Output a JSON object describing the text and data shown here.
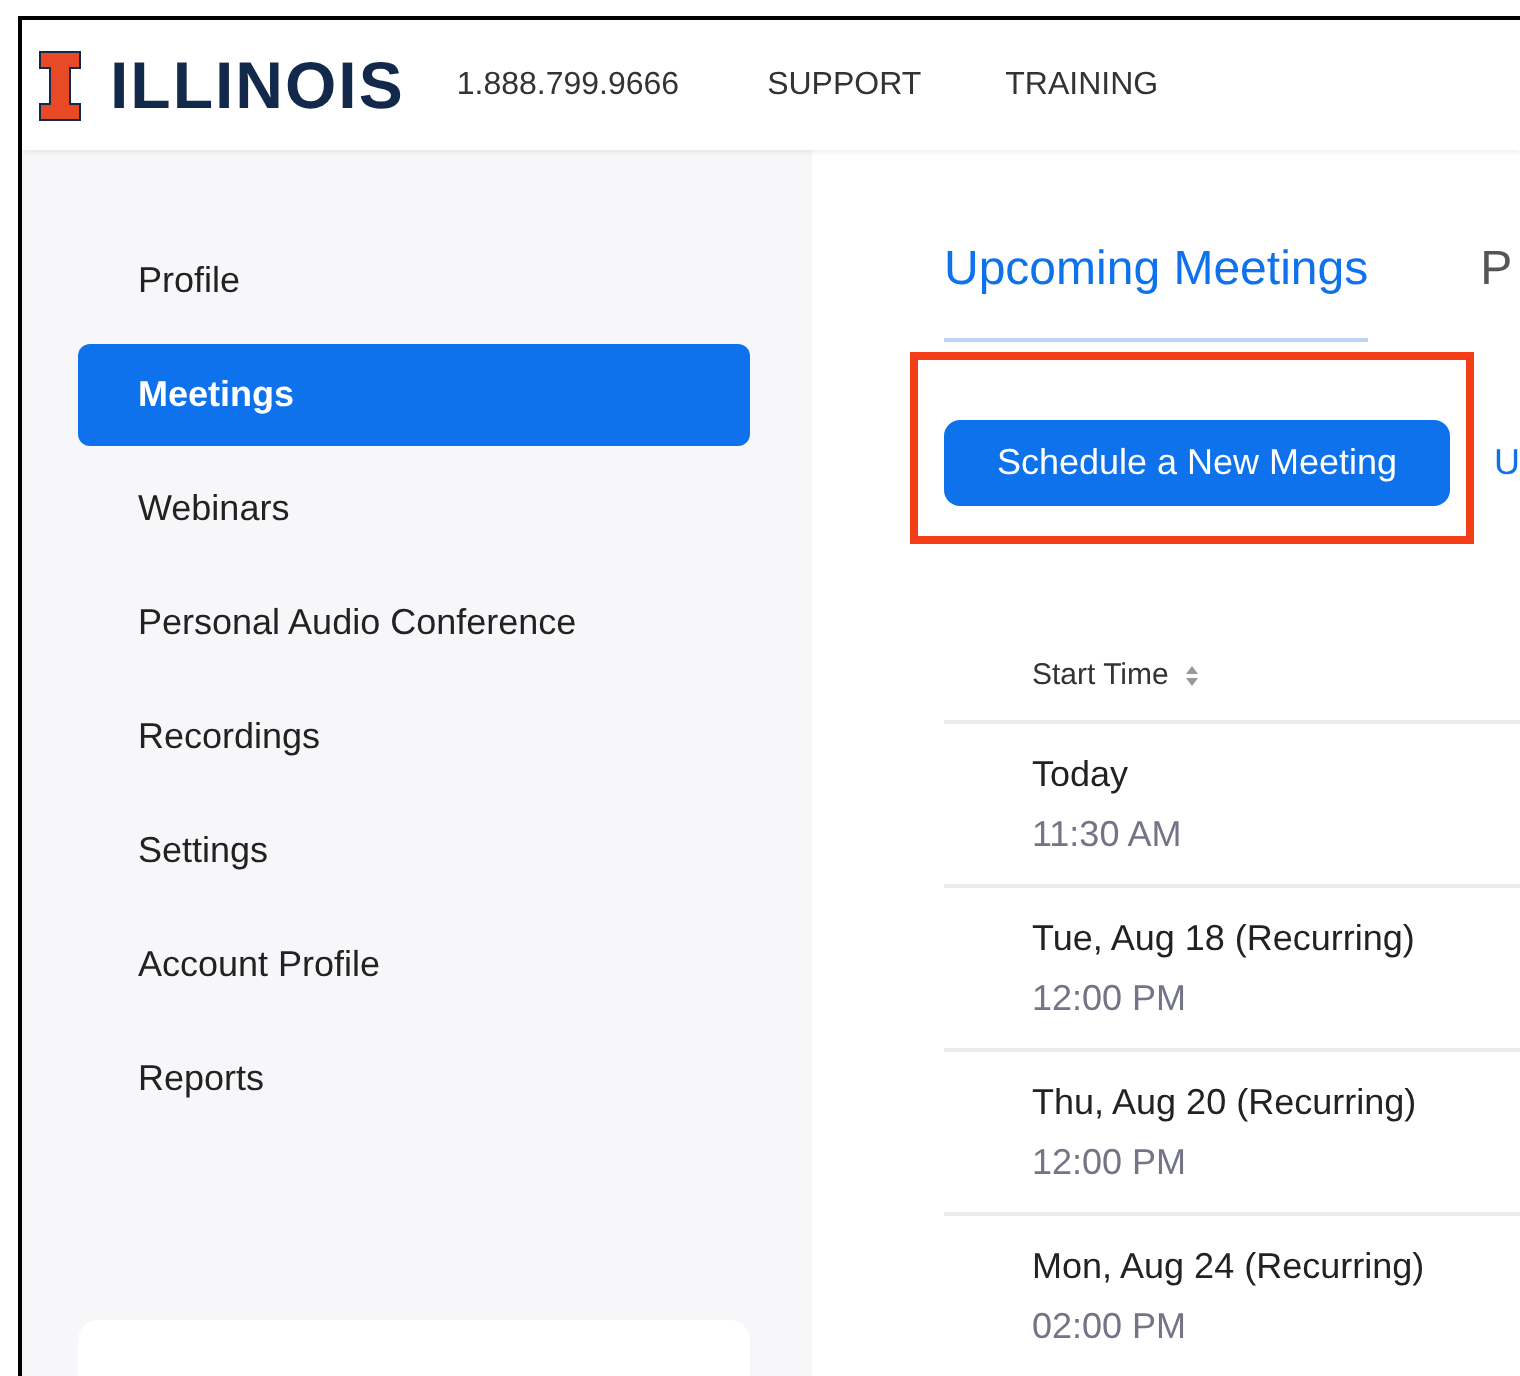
{
  "header": {
    "brand": "ILLINOIS",
    "phone": "1.888.799.9666",
    "links": [
      "SUPPORT",
      "TRAINING"
    ]
  },
  "sidebar": {
    "items": [
      {
        "label": "Profile",
        "selected": false
      },
      {
        "label": "Meetings",
        "selected": true
      },
      {
        "label": "Webinars",
        "selected": false
      },
      {
        "label": "Personal Audio Conference",
        "selected": false
      },
      {
        "label": "Recordings",
        "selected": false
      },
      {
        "label": "Settings",
        "selected": false
      },
      {
        "label": "Account Profile",
        "selected": false
      },
      {
        "label": "Reports",
        "selected": false
      }
    ]
  },
  "tabs": [
    {
      "label": "Upcoming Meetings",
      "selected": true
    },
    {
      "label": "P",
      "selected": false
    }
  ],
  "schedule_button": "Schedule a New Meeting",
  "cut_link": "U",
  "table": {
    "columns": [
      "Start Time"
    ],
    "rows": [
      {
        "date": "Today",
        "time": "11:30 AM"
      },
      {
        "date": "Tue, Aug 18 (Recurring)",
        "time": "12:00 PM"
      },
      {
        "date": "Thu, Aug 20 (Recurring)",
        "time": "12:00 PM"
      },
      {
        "date": "Mon, Aug 24 (Recurring)",
        "time": "02:00 PM"
      }
    ]
  }
}
